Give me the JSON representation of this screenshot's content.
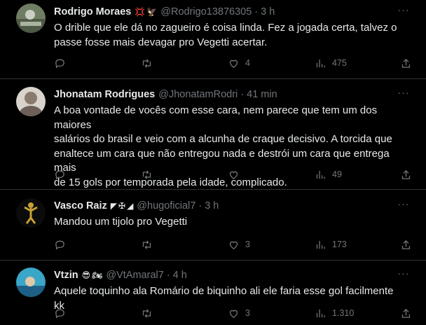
{
  "tweets": [
    {
      "name": "Rodrigo Moraes",
      "badges": [
        "💢",
        "🦅"
      ],
      "handle": "@Rodrigo13876305",
      "separator": "·",
      "time": "3 h",
      "lines": [
        "O drible que ele dá no zagueiro é coisa linda. Fez a jogada certa, talvez o",
        "passe fosse mais devagar pro Vegetti acertar."
      ],
      "reply_count": "",
      "retweet_count": "",
      "like_count": "4",
      "view_count": "475",
      "avatar_colors": [
        "#6f7e62",
        "#c9cfc2"
      ]
    },
    {
      "name": "Jhonatam Rodrigues",
      "badges": [],
      "handle": "@JhonatamRodri",
      "separator": "·",
      "time": "41 min",
      "lines": [
        "A boa vontade de vocês com esse cara, nem parece que tem um dos maiores",
        "salários do brasil e veio com a alcunha de craque decisivo. A torcida que",
        "enaltece um cara que não entregou nada e destrói um cara que entrega mais",
        "de 15 gols por temporada pela idade, complicado."
      ],
      "reply_count": "",
      "retweet_count": "",
      "like_count": "",
      "view_count": "49",
      "avatar_colors": [
        "#8a7a6c",
        "#d8d3cc"
      ]
    },
    {
      "name": "Vasco Raiz",
      "badges": [
        "◤",
        "✠",
        "◢"
      ],
      "handle": "@hugoficial7",
      "separator": "·",
      "time": "3 h",
      "lines": [
        "Mandou um tijolo pro Vegetti"
      ],
      "reply_count": "",
      "retweet_count": "",
      "like_count": "3",
      "view_count": "173",
      "avatar_colors": [
        "#0b0b0b",
        "#c8a030"
      ]
    },
    {
      "name": "Vtzin",
      "badges": [
        "😎",
        "🏍"
      ],
      "handle": "@VtAmaral7",
      "separator": "·",
      "time": "4 h",
      "lines": [
        "Aquele toquinho ala Romário de biquinho ali ele faria esse gol facilmente kk"
      ],
      "reply_count": "",
      "retweet_count": "",
      "like_count": "3",
      "view_count": "1.310",
      "avatar_colors": [
        "#3aa6c8",
        "#1d5f85"
      ]
    }
  ],
  "icons": {
    "more": "more-icon",
    "reply": "reply-icon",
    "retweet": "retweet-icon",
    "like": "like-icon",
    "views": "views-icon",
    "share": "share-icon"
  },
  "more_glyph": "···"
}
